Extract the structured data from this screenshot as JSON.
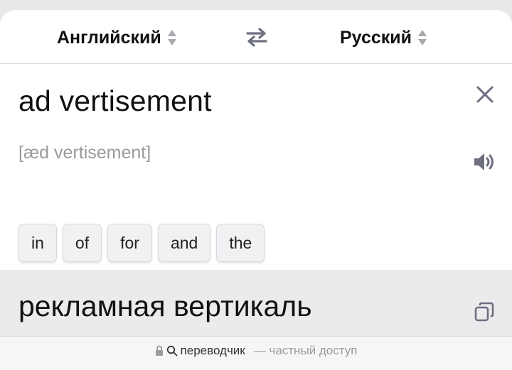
{
  "languages": {
    "source": "Английский",
    "target": "Русский"
  },
  "source": {
    "text": "ad vertisement",
    "transcription": "[æd vertisement]"
  },
  "suggestions": [
    "in",
    "of",
    "for",
    "and",
    "the"
  ],
  "translation": {
    "text": "рекламная вертикаль"
  },
  "address_bar": {
    "host": "переводчик",
    "note": "— частный доступ"
  },
  "icons": {
    "sort": "sort-updown-icon",
    "swap": "swap-arrows-icon",
    "clear": "close-icon",
    "speak": "speaker-icon",
    "copy": "copy-icon",
    "lock": "lock-icon",
    "search": "search-icon"
  },
  "colors": {
    "accent_icon": "#6d6f80",
    "muted_text": "#9a9aa0",
    "translation_bg": "#ebebee"
  }
}
